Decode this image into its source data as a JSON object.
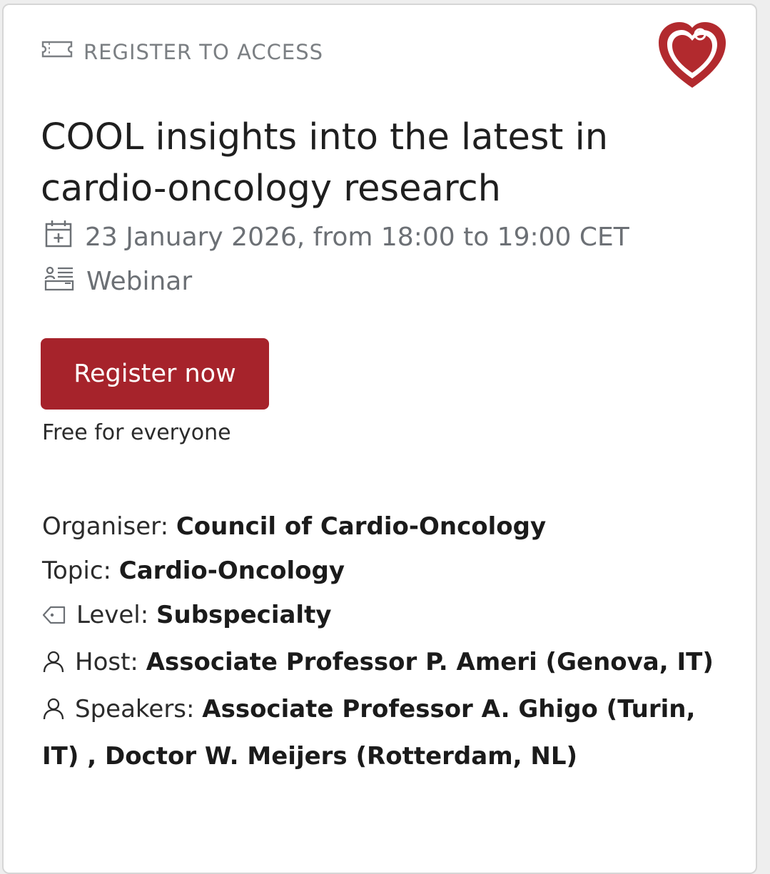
{
  "access_label": "REGISTER TO ACCESS",
  "title": "COOL insights into the latest in cardio-oncology research",
  "date_text": "23 January 2026, from 18:00 to 19:00 CET",
  "event_type": "Webinar",
  "register_button": "Register now",
  "price_note": "Free for everyone",
  "details": {
    "organiser_label": "Organiser: ",
    "organiser_value": "Council of Cardio-Oncology",
    "topic_label": "Topic: ",
    "topic_value": "Cardio-Oncology",
    "level_label": "Level: ",
    "level_value": "Subspecialty",
    "host_label": "Host: ",
    "host_value": "Associate Professor P. Ameri (Genova, IT)",
    "speakers_label": "Speakers: ",
    "speakers_value": "Associate Professor A. Ghigo (Turin, IT) , Doctor W. Meijers (Rotterdam, NL)"
  },
  "icons": {
    "access": "ticket-icon",
    "logo": "heart-logo",
    "date": "calendar-icon",
    "type": "webinar-icon",
    "level": "tag-icon",
    "host": "person-icon",
    "speakers": "person-icon"
  },
  "colors": {
    "accent": "#a6232b",
    "muted": "#7b7f83"
  }
}
